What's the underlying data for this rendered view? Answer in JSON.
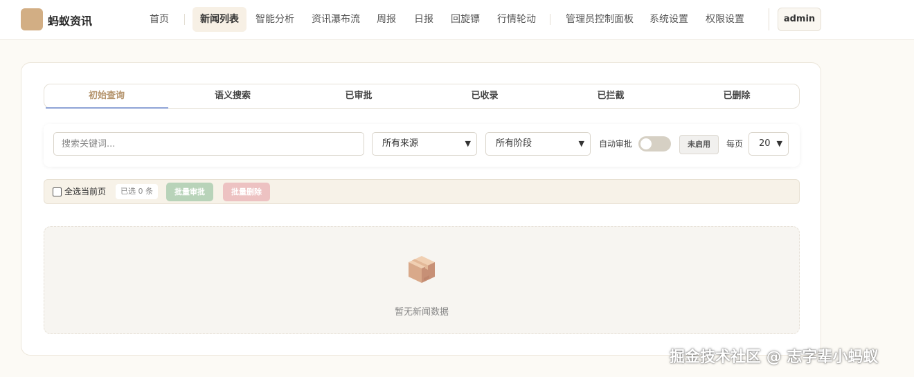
{
  "app": {
    "name": "蚂蚁资讯"
  },
  "nav": {
    "items": [
      "首页",
      "新闻列表",
      "智能分析",
      "资讯瀑布流",
      "周报",
      "日报",
      "回旋镖",
      "行情轮动",
      "管理员控制面板",
      "系统设置",
      "权限设置"
    ],
    "active": "新闻列表",
    "user": "admin"
  },
  "tabs": {
    "items": [
      "初始查询",
      "语义搜索",
      "已审批",
      "已收录",
      "已拦截",
      "已删除"
    ],
    "active": "初始查询"
  },
  "filters": {
    "search_placeholder": "搜索关键词...",
    "source_select": "所有来源",
    "stage_select": "所有阶段",
    "auto_approve_label": "自动审批",
    "auto_approve_on": false,
    "auto_approve_status": "未启用",
    "page_size_label": "每页",
    "page_size": "20"
  },
  "bulk": {
    "select_all_label": "全选当前页",
    "selected_count": "已选 0 条",
    "approve_label": "批量审批",
    "delete_label": "批量删除"
  },
  "empty": {
    "icon": "package-icon",
    "text": "暂无新闻数据"
  },
  "watermark": "掘金技术社区 @ 志字辈小蚂蚁",
  "colors": {
    "accent": "#b3926a",
    "logo": "#d2ae84",
    "approve": "#b8d3b9",
    "delete": "#edc2c2",
    "tab_underline": "#8ea3d6"
  }
}
